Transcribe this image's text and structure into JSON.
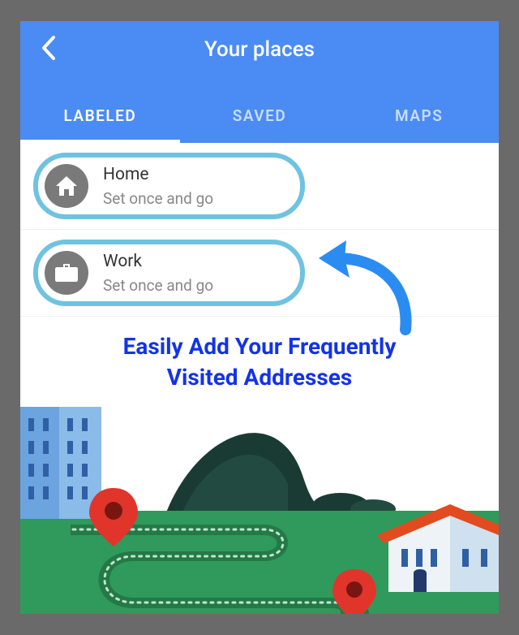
{
  "header": {
    "title": "Your places"
  },
  "tabs": {
    "labeled": "LABELED",
    "saved": "SAVED",
    "maps": "MAPS"
  },
  "places": {
    "home": {
      "label": "Home",
      "sub": "Set once and go"
    },
    "work": {
      "label": "Work",
      "sub": "Set once and go"
    }
  },
  "callout": {
    "line1": "Easily Add Your Frequently",
    "line2": "Visited Addresses"
  }
}
